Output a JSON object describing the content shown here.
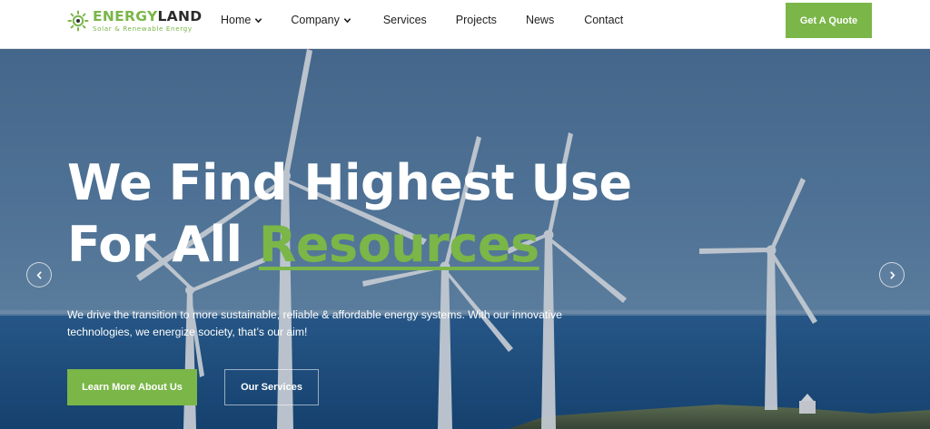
{
  "brand": {
    "name_part1": "ENERGY",
    "name_part2": "LAND",
    "tagline": "Solar & Renewable Energy",
    "logo_icon": "sun-icon",
    "accent_color": "#7ab648"
  },
  "nav": {
    "items": [
      {
        "label": "Home",
        "has_dropdown": true
      },
      {
        "label": "Company",
        "has_dropdown": true
      },
      {
        "label": "Services",
        "has_dropdown": false
      },
      {
        "label": "Projects",
        "has_dropdown": false
      },
      {
        "label": "News",
        "has_dropdown": false
      },
      {
        "label": "Contact",
        "has_dropdown": false
      }
    ],
    "cta_label": "Get A Quote"
  },
  "hero": {
    "title_line1": "We Find Highest Use",
    "title_line2_prefix": "For All ",
    "title_highlight": "Resources",
    "description": "We drive the transition to more sustainable, reliable & affordable energy systems. With our innovative technologies, we energize society, that’s our aim!",
    "primary_button": "Learn More About Us",
    "secondary_button": "Our Services",
    "prev_icon": "chevron-left-icon",
    "next_icon": "chevron-right-icon",
    "background": "wind-turbines-over-sea"
  }
}
